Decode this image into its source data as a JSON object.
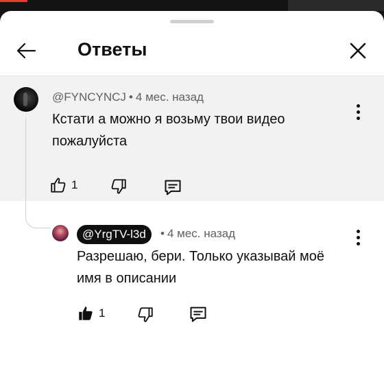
{
  "header": {
    "title": "Ответы"
  },
  "comments": [
    {
      "author": "@FYNCYNCJ",
      "time": "4 мес. назад",
      "text_line1": "Кстати а можно я возьму твои видео",
      "text_line2": "пожалуйста",
      "likes": "1"
    },
    {
      "author": "@YrgTV-l3d",
      "time": "4 мес. назад",
      "text_line1": "Разрешаю, бери. Только указывай моё",
      "text_line2": "имя в описании",
      "likes": "1",
      "liked": true
    }
  ],
  "icons": {
    "back": "back-arrow-icon",
    "close": "close-icon",
    "more": "more-vert-icon",
    "like": "thumb-up-icon",
    "dislike": "thumb-down-icon",
    "reply": "reply-comment-icon"
  },
  "colors": {
    "author_chip_bg": "#0f0f0f",
    "selected_comment_bg": "#f2f2f2"
  }
}
